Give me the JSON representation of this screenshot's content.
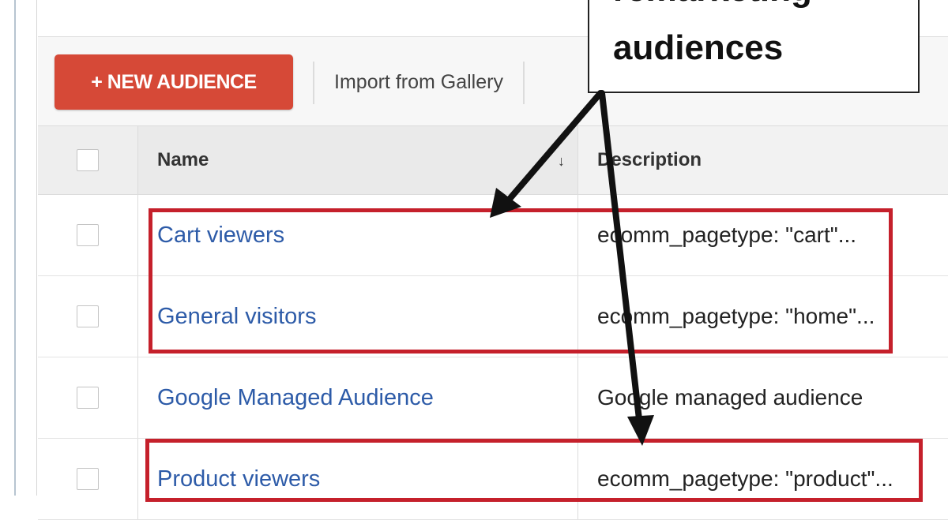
{
  "toolbar": {
    "new_audience_label": "+ NEW AUDIENCE",
    "import_label": "Import from Gallery"
  },
  "table": {
    "columns": [
      "Name",
      "Description"
    ],
    "sort_indicator": "↓",
    "rows": [
      {
        "name": "Cart viewers",
        "description": "ecomm_pagetype: \"cart\"..."
      },
      {
        "name": "General visitors",
        "description": "ecomm_pagetype: \"home\"..."
      },
      {
        "name": "Google Managed Audience",
        "description": "Google managed audience"
      },
      {
        "name": "Product viewers",
        "description": "ecomm_pagetype: \"product\"..."
      }
    ]
  },
  "callout": {
    "line1": "remarketing",
    "line2": "audiences"
  },
  "colors": {
    "primary_button": "#d64937",
    "link": "#2d5ba8",
    "highlight": "#c5202b"
  }
}
